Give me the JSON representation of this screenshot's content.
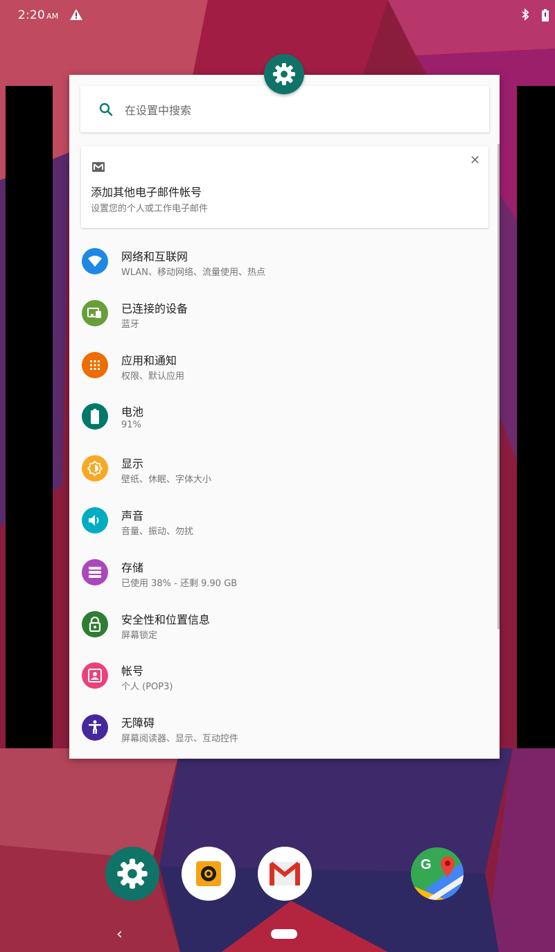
{
  "status_bar": {
    "time": "2:20",
    "ampm": "AM",
    "icons": [
      "warning-icon",
      "bluetooth-icon",
      "battery-icon"
    ]
  },
  "recents_card": {
    "app_icon": "settings-gear-icon",
    "search": {
      "placeholder": "在设置中搜索"
    },
    "suggestion": {
      "icon": "mail-icon",
      "title": "添加其他电子邮件帐号",
      "subtitle": "设置您的个人或工作电子邮件",
      "close_icon": "close-icon"
    },
    "settings": [
      {
        "label": "网络和互联网",
        "sub": "WLAN、移动网络、流量使用、热点",
        "icon": "wifi-icon",
        "color": "#1e88e5"
      },
      {
        "label": "已连接的设备",
        "sub": "蓝牙",
        "icon": "devices-icon",
        "color": "#689f38"
      },
      {
        "label": "应用和通知",
        "sub": "权限、默认应用",
        "icon": "apps-icon",
        "color": "#ef6c00"
      },
      {
        "label": "电池",
        "sub": "91%",
        "icon": "battery-icon",
        "color": "#00796b"
      },
      {
        "label": "显示",
        "sub": "壁纸、休眠、字体大小",
        "icon": "brightness-icon",
        "color": "#f9a825"
      },
      {
        "label": "声音",
        "sub": "音量、振动、勿扰",
        "icon": "volume-icon",
        "color": "#00acc1"
      },
      {
        "label": "存储",
        "sub": "已使用 38% - 还剩 9.90 GB",
        "icon": "storage-icon",
        "color": "#ab47bc"
      },
      {
        "label": "安全性和位置信息",
        "sub": "屏幕锁定",
        "icon": "lock-icon",
        "color": "#2e7d32"
      },
      {
        "label": "帐号",
        "sub": "个人 (POP3)",
        "icon": "account-icon",
        "color": "#ec407a"
      },
      {
        "label": "无障碍",
        "sub": "屏幕阅读器、显示、互动控件",
        "icon": "accessibility-icon",
        "color": "#4527a0"
      }
    ]
  },
  "dock": [
    "settings-app-icon",
    "camera-app-icon",
    "gmail-app-icon",
    "maps-app-icon"
  ],
  "nav": {
    "back": "‹"
  }
}
